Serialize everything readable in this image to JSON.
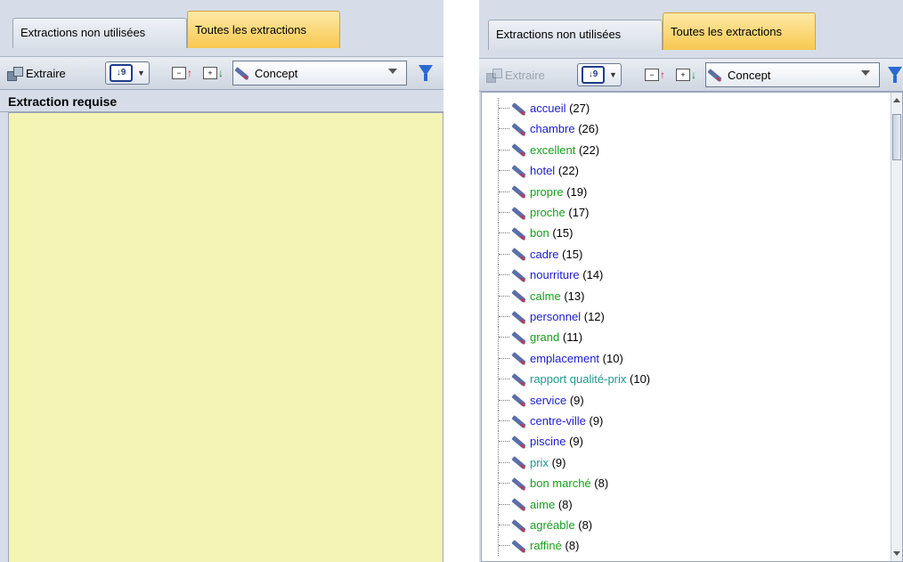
{
  "colors": {
    "active_tab": "#f8c850",
    "yellow_area": "#f4f4b4",
    "blue_term": "#1c1cd0",
    "green_term": "#16a01c",
    "teal_term": "#1e9a8e"
  },
  "left": {
    "tabs": {
      "unused": "Extractions non utilisées",
      "all": "Toutes les extractions"
    },
    "toolbar": {
      "extract_label": "Extraire",
      "sort_icon": "sort-icon",
      "concept_label": "Concept"
    },
    "required_header": "Extraction requise"
  },
  "right": {
    "tabs": {
      "unused": "Extractions non utilisées",
      "all": "Toutes les extractions"
    },
    "toolbar": {
      "extract_label": "Extraire",
      "sort_icon": "sort-icon",
      "concept_label": "Concept"
    },
    "concepts": [
      {
        "term": "accueil",
        "count": "(27)",
        "color": "#1c1cd0"
      },
      {
        "term": "chambre",
        "count": "(26)",
        "color": "#1c1cd0"
      },
      {
        "term": "excellent",
        "count": "(22)",
        "color": "#16a01c"
      },
      {
        "term": "hotel",
        "count": "(22)",
        "color": "#1c1cd0"
      },
      {
        "term": "propre",
        "count": "(19)",
        "color": "#16a01c"
      },
      {
        "term": "proche",
        "count": "(17)",
        "color": "#16a01c"
      },
      {
        "term": "bon",
        "count": "(15)",
        "color": "#16a01c"
      },
      {
        "term": "cadre",
        "count": "(15)",
        "color": "#1c1cd0"
      },
      {
        "term": "nourriture",
        "count": "(14)",
        "color": "#1c1cd0"
      },
      {
        "term": "calme",
        "count": "(13)",
        "color": "#16a01c"
      },
      {
        "term": "personnel",
        "count": "(12)",
        "color": "#1c1cd0"
      },
      {
        "term": "grand",
        "count": "(11)",
        "color": "#16a01c"
      },
      {
        "term": "emplacement",
        "count": "(10)",
        "color": "#1c1cd0"
      },
      {
        "term": "rapport qualité-prix",
        "count": "(10)",
        "color": "#1e9a8e"
      },
      {
        "term": "service",
        "count": "(9)",
        "color": "#1c1cd0"
      },
      {
        "term": "centre-ville",
        "count": "(9)",
        "color": "#1c1cd0"
      },
      {
        "term": "piscine",
        "count": "(9)",
        "color": "#1c1cd0"
      },
      {
        "term": "prix",
        "count": "(9)",
        "color": "#1e9a8e"
      },
      {
        "term": "bon marché",
        "count": "(8)",
        "color": "#16a01c"
      },
      {
        "term": "aime",
        "count": "(8)",
        "color": "#16a01c"
      },
      {
        "term": "agréable",
        "count": "(8)",
        "color": "#16a01c"
      },
      {
        "term": "raffiné",
        "count": "(8)",
        "color": "#16a01c"
      }
    ]
  }
}
